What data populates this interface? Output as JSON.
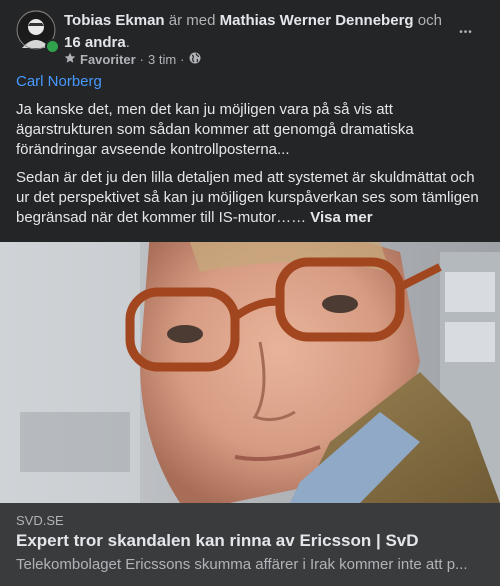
{
  "post": {
    "author": "Tobias Ekman",
    "with_text": " är med ",
    "tagged": "Mathias Werner Denneberg",
    "and_text": " och ",
    "others": "16 andra",
    "period": ".",
    "audience": "Favoriter",
    "time": "3 tim",
    "separator": "·",
    "more_label": "•••",
    "mention": "Carl Norberg",
    "paragraph1": "Ja kanske det, men det kan ju möjligen vara på så vis att ägarstrukturen som sådan kommer att genomgå dramatiska förändringar avseende kontrollposterna...",
    "paragraph2": "Sedan är det ju den lilla detaljen med att systemet är skuldmättat och ur det perspektivet så kan ju möjligen kurspåverkan ses som tämligen begränsad när det kommer till IS-mutor……",
    "see_more": "Visa mer"
  },
  "link_preview": {
    "domain": "SVD.SE",
    "title": "Expert tror skandalen kan rinna av Ericsson | SvD",
    "description": "Telekombolaget Ericssons skumma affärer i Irak kommer inte att p..."
  },
  "icons": {
    "audience": "star-icon",
    "privacy": "globe-icon",
    "more": "more-options-icon"
  },
  "colors": {
    "card_bg": "#242526",
    "link_bg": "#3a3b3c",
    "accent": "#4599ff",
    "online": "#31a24c"
  }
}
